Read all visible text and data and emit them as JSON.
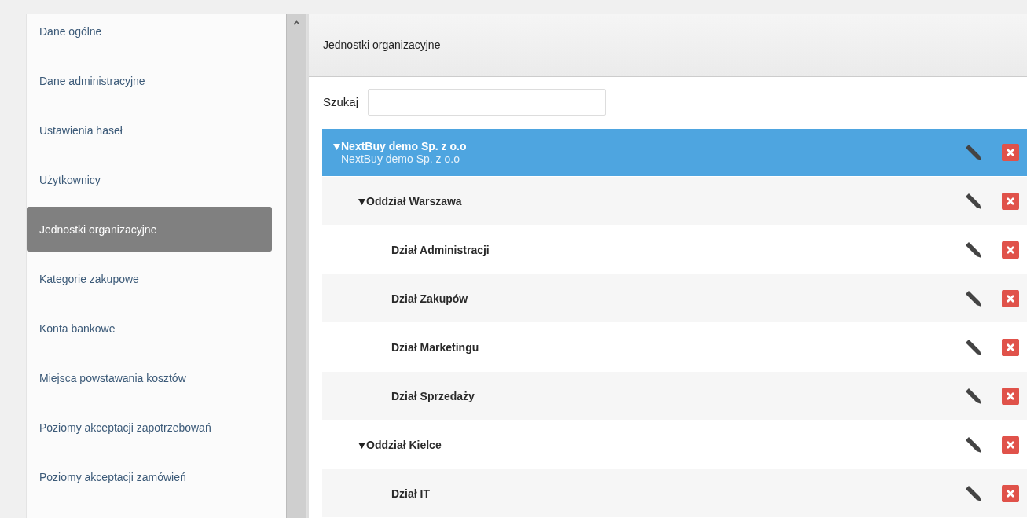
{
  "sidebar": {
    "items": [
      {
        "label": "Dane ogólne",
        "selected": false
      },
      {
        "label": "Dane administracyjne",
        "selected": false
      },
      {
        "label": "Ustawienia haseł",
        "selected": false
      },
      {
        "label": "Użytkownicy",
        "selected": false
      },
      {
        "label": "Jednostki organizacyjne",
        "selected": true
      },
      {
        "label": "Kategorie zakupowe",
        "selected": false
      },
      {
        "label": "Konta bankowe",
        "selected": false
      },
      {
        "label": "Miejsca powstawania kosztów",
        "selected": false
      },
      {
        "label": "Poziomy akceptacji zapotrzebowań",
        "selected": false
      },
      {
        "label": "Poziomy akceptacji zamówień",
        "selected": false
      }
    ]
  },
  "panel": {
    "title": "Jednostki organizacyjne",
    "search": {
      "label": "Szukaj"
    },
    "tree": [
      {
        "name": "NextBuy demo Sp. z o.o",
        "subtitle": "NextBuy demo Sp. z o.o",
        "selected": true,
        "expanded": true,
        "children": [
          {
            "name": "Oddział Warszawa",
            "selected": false,
            "expanded": true,
            "children": [
              {
                "name": "Dział Administracji",
                "selected": false
              },
              {
                "name": "Dział Zakupów",
                "selected": false
              },
              {
                "name": "Dział Marketingu",
                "selected": false
              },
              {
                "name": "Dział Sprzedaży",
                "selected": false
              }
            ]
          },
          {
            "name": "Oddział Kielce",
            "selected": false,
            "expanded": true,
            "children": [
              {
                "name": "Dział IT",
                "selected": false
              }
            ]
          }
        ]
      }
    ]
  }
}
